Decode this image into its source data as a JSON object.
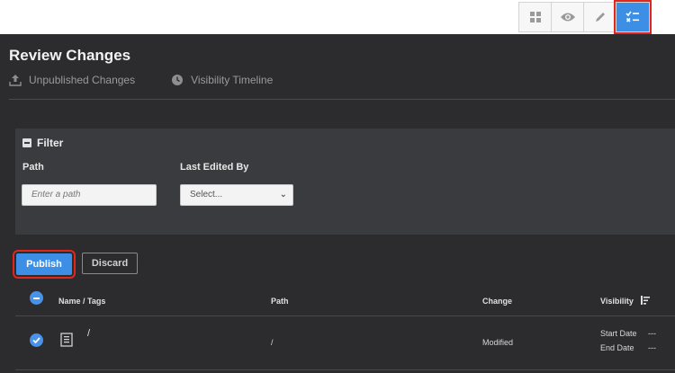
{
  "toolbar": {
    "items": [
      {
        "name": "grid-view",
        "icon": "grid-icon",
        "active": false
      },
      {
        "name": "preview",
        "icon": "eye-icon",
        "active": false
      },
      {
        "name": "edit",
        "icon": "pencil-icon",
        "active": false
      },
      {
        "name": "review-changes",
        "icon": "checklist-icon",
        "active": true
      }
    ]
  },
  "page": {
    "title": "Review Changes",
    "tabs": [
      {
        "label": "Unpublished Changes",
        "icon": "upload-icon"
      },
      {
        "label": "Visibility Timeline",
        "icon": "clock-icon"
      }
    ]
  },
  "filter": {
    "title": "Filter",
    "path_label": "Path",
    "path_placeholder": "Enter a path",
    "edited_by_label": "Last Edited By",
    "edited_by_value": "Select..."
  },
  "actions": {
    "publish_label": "Publish",
    "discard_label": "Discard"
  },
  "table": {
    "headers": {
      "name": "Name / Tags",
      "path": "Path",
      "change": "Change",
      "visibility": "Visibility"
    },
    "rows": [
      {
        "name": "/",
        "path": "/",
        "change": "Modified",
        "start_label": "Start Date",
        "start_value": "---",
        "end_label": "End Date",
        "end_value": "---"
      }
    ]
  },
  "colors": {
    "accent": "#3d8fe6",
    "highlight": "#e2261d",
    "background": "#2c2c2e",
    "panel": "#3a3b3e"
  }
}
